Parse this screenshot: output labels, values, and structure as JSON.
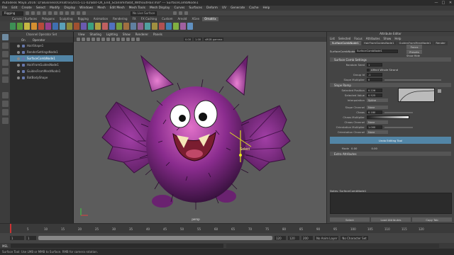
{
  "titlebar": {
    "title": "Autodesk Maya 2016: D:\\Business\\Ornatrix\\2015-11-02\\Bat-OX_End_Scanlimit\\Bat_WithoutHair.ma* --- SurfaceCombNode1",
    "minimize": "—",
    "maximize": "□",
    "close": "✕"
  },
  "menubar": [
    "File",
    "Edit",
    "Create",
    "Select",
    "Modify",
    "Display",
    "Windows",
    "Mesh",
    "Edit Mesh",
    "Mesh Tools",
    "Mesh Display",
    "Curves",
    "Surfaces",
    "Deform",
    "UV",
    "Generate",
    "Cache",
    "Help"
  ],
  "statusline": {
    "mode": "Rigging",
    "no_live_surface": "No Live Surface"
  },
  "shelf_tabs": [
    "Curves / Surfaces",
    "Polygons",
    "Sculpting",
    "Rigging",
    "Animation",
    "Rendering",
    "FX",
    "FX Caching",
    "Custom",
    "Arnold",
    "XGen",
    "Ornatrix"
  ],
  "shelf_active": "Ornatrix",
  "outliner": {
    "title": "Channel Operator Set",
    "cols": [
      "On",
      "Operator"
    ],
    "items": [
      {
        "label": "HairShape1",
        "selected": false
      },
      {
        "label": "RenderSettingsNode1",
        "selected": false
      },
      {
        "label": "SurfaceCombNode1",
        "selected": true
      },
      {
        "label": "HairFromGuidesNode1",
        "selected": false
      },
      {
        "label": "GuidesFromMeshNode1",
        "selected": false
      },
      {
        "label": "BatBodyShape",
        "selected": false
      }
    ]
  },
  "viewport": {
    "menu": [
      "View",
      "Shading",
      "Lighting",
      "Show",
      "Renderer",
      "Panels"
    ],
    "colorspace": "sRGB gamma",
    "camera": "persp",
    "tool_tooltip": "Select"
  },
  "attr_editor": {
    "title": "Attribute Editor",
    "menu": [
      "List",
      "Selected",
      "Focus",
      "Attributes",
      "Show",
      "Help"
    ],
    "tabs": [
      "SurfaceCombNode1",
      "HairFromGuidesNode1",
      "GuidesFromMeshNode1",
      "Render"
    ],
    "node_label": "SurfaceCombNode:",
    "node_value": "SurfaceCombNode1",
    "focus": "Focus",
    "presets": "Presets",
    "show": "Show",
    "hide": "Hide",
    "section1": "Surface Comb Settings",
    "random_seed_label": "Random Seed",
    "random_seed": "1",
    "affect_whole_strand": "Affect Whole Strand",
    "group_id_label": "Group Id",
    "group_id": "-1",
    "slope_mult_label": "Slope Multiplier",
    "slope_mult": "0",
    "section2": "Slope Ramp",
    "sel_pos_label": "Selected Position",
    "sel_pos": "0.226",
    "sel_val_label": "Selected Value",
    "sel_val": "0.525",
    "interp_label": "Interpolation",
    "interp": "Spline",
    "slope_channel_label": "Slope Channel",
    "slope_channel": "None",
    "chaos_label": "Chaos",
    "chaos": "0.180",
    "chaos_mult_label": "Chaos Multiplier",
    "chaos_channel_label": "Chaos Channel",
    "chaos_channel": "None",
    "orient_mult_label": "Orientation Multiplier",
    "orient_mult": "1.000",
    "orient_channel_label": "Orientation Channel",
    "orient_channel": "None",
    "undo_btn": "Undo Editing Tool",
    "mode_label": "Mode",
    "mode_value": "0.00",
    "mode_value2": "0.00",
    "section3": "Extra Attributes",
    "notes_label": "Notes: SurfaceCombNode1",
    "select_btn": "Select",
    "load_btn": "Load Attributes",
    "copy_btn": "Copy Tab"
  },
  "timeline": {
    "ticks": [
      "5",
      "10",
      "15",
      "20",
      "25",
      "30",
      "35",
      "40",
      "45",
      "50",
      "55",
      "60",
      "65",
      "70",
      "75",
      "80",
      "85",
      "90",
      "95",
      "100",
      "105",
      "110",
      "115",
      "120"
    ],
    "current_frame": "1"
  },
  "range": {
    "start": "1",
    "range_start": "1",
    "range_end": "120",
    "end": "120",
    "end2": "200",
    "anim_layer": "No Anim Layer",
    "char_set": "No Character Set"
  },
  "cmdline": {
    "lang": "MEL"
  },
  "helpline": "Surface Tool: Use LMB or MMB to Surface. RMB for camera rotation."
}
